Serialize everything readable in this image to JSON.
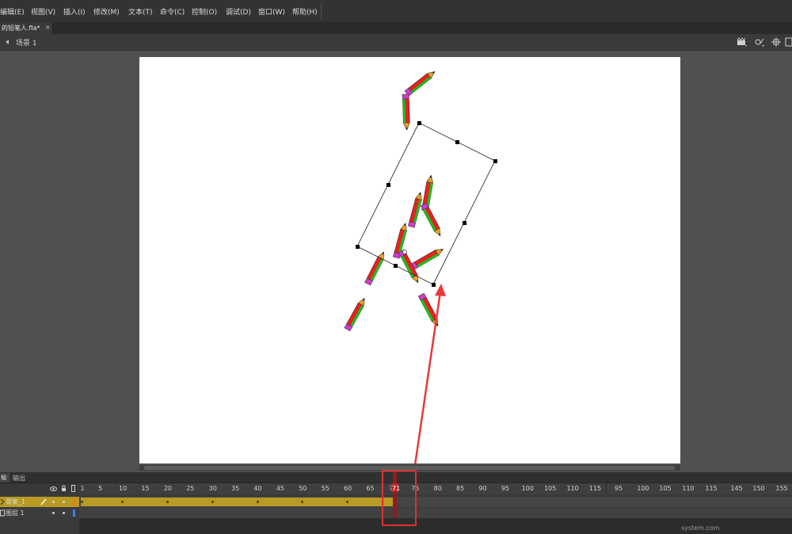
{
  "menu": {
    "items": [
      "编辑(E)",
      "视图(V)",
      "插入(I)",
      "修改(M)",
      "文本(T)",
      "命令(C)",
      "控制(O)",
      "调试(D)",
      "窗口(W)",
      "帮助(H)"
    ]
  },
  "document": {
    "tab_title": "的铅笔人.fla*",
    "close_symbol": "×"
  },
  "edit_bar": {
    "scene_label": "场景 1",
    "tools": [
      "edit-scene-icon",
      "edit-symbol-icon",
      "center-stage-icon",
      "clip-icon"
    ]
  },
  "timeline": {
    "panel_tab_timeline": "轴",
    "panel_tab_output": "输出",
    "ruler_labels": [
      "1",
      "5",
      "10",
      "15",
      "20",
      "25",
      "30",
      "35",
      "40",
      "45",
      "50",
      "55",
      "60",
      "65",
      "70",
      "75",
      "80",
      "85",
      "90",
      "95",
      "100",
      "105",
      "110",
      "115"
    ],
    "ruler_overlay_labels": [
      "95",
      "100",
      "105",
      "110",
      "115",
      "145",
      "150",
      "155"
    ],
    "current_frame": "71",
    "layers": [
      {
        "name": "骨架_1",
        "type": "armature",
        "color": "#f07820"
      },
      {
        "name": "图层 1",
        "type": "normal",
        "color": "#3f7ff0"
      }
    ],
    "armature_span_frames": 71
  },
  "watermark": "system.com"
}
